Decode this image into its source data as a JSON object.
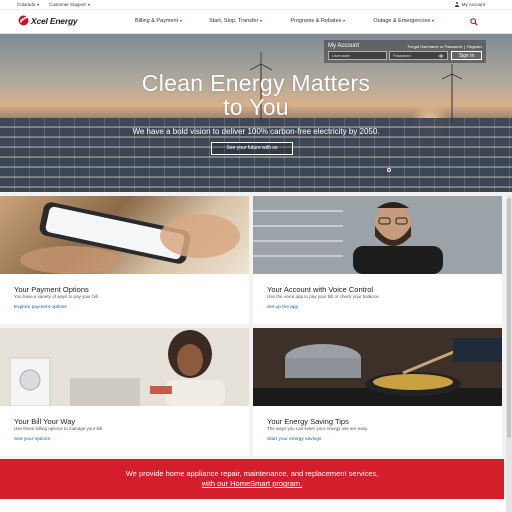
{
  "utility": {
    "state": "Colorado",
    "support": "Customer Support",
    "my_account": "My Account"
  },
  "nav": {
    "logo_text": "Xcel Energy",
    "items": [
      {
        "label": "Billing & Payment"
      },
      {
        "label": "Start, Stop, Transfer"
      },
      {
        "label": "Programs & Rebates"
      },
      {
        "label": "Outage & Emergencies"
      }
    ],
    "icons": {
      "search": "search-icon"
    }
  },
  "hero": {
    "title_line1": "Clean Energy Matters",
    "title_line2": "to You",
    "subtitle": "We have a bold vision to deliver 100% carbon-free electricity by 2050.",
    "cta": "See your future with us"
  },
  "account": {
    "title": "My Account",
    "forgot": "Forgot Username or Password",
    "separator": "|",
    "register": "Register",
    "username_placeholder": "Username",
    "password_placeholder": "Password",
    "signin": "Sign In"
  },
  "cards": [
    {
      "title": "Your Payment Options",
      "desc": "You have a variety of ways to pay your bill.",
      "link": "Explore payment options"
    },
    {
      "title": "Your Account with Voice Control",
      "desc": "Use the voice app to pay your bill or check your balance.",
      "link": "Set up the app"
    },
    {
      "title": "Your Bill Your Way",
      "desc": "Use these billing options to manage your bill.",
      "link": "See your options"
    },
    {
      "title": "Your Energy Saving Tips",
      "desc": "The ways you can lower your energy use are easy.",
      "link": "Start your energy savings"
    }
  ],
  "banner": {
    "line1": "We provide home appliance repair, maintenance, and replacement services,",
    "line2": "with our HomeSmart program."
  },
  "colors": {
    "brand_red": "#c8102e",
    "banner_red": "#d41e2c",
    "link_blue": "#1b5ea9"
  }
}
